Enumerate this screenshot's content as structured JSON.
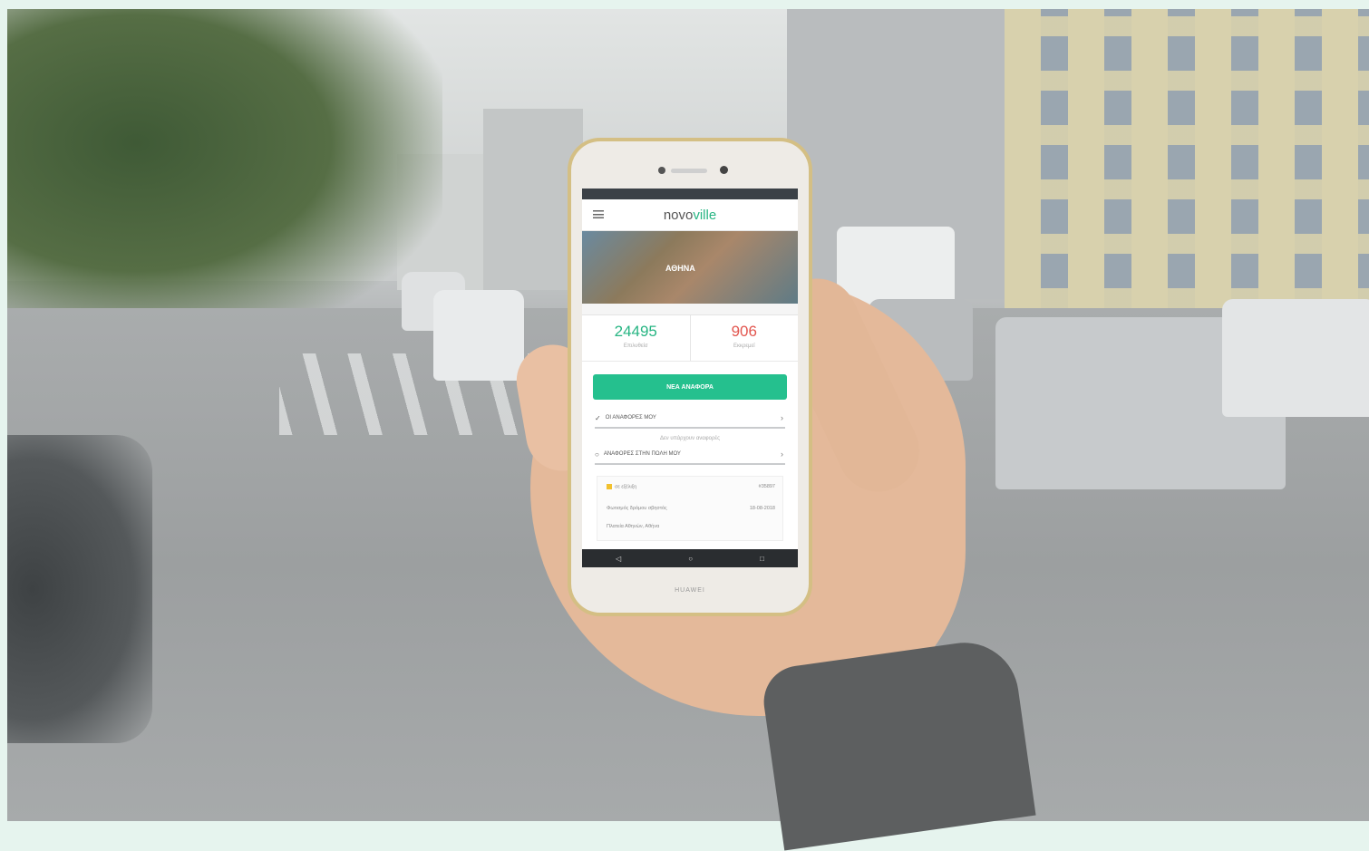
{
  "app": {
    "brand_part1": "novo",
    "brand_part2": "ville",
    "city_label": "ΑΘΗΝΑ"
  },
  "stats": [
    {
      "value": "24495",
      "caption": "Επιλυθείσ"
    },
    {
      "value": "906",
      "caption": "Εκκρεμεί"
    }
  ],
  "cta_label": "ΝΕΑ ΑΝΑΦΟΡΑ",
  "sections": {
    "my_reports": "ΟΙ ΑΝΑΦΟΡΕΣ ΜΟΥ",
    "empty_note": "Δεν υπάρχουν αναφορές",
    "city_reports": "ΑΝΑΦΟΡΕΣ ΣΤΗΝ ΠΟΛΗ ΜΟΥ"
  },
  "report_card": {
    "tag": "σε εξέλιξη",
    "number": "#35897",
    "title": "Φωτισμός δρόμου σβηστός",
    "date": "18-08-2018",
    "address": "Πλατεία Αθηνών, Αθήνα"
  },
  "navbar": {
    "back": "◁",
    "home": "○",
    "recent": "□"
  },
  "device_maker": "HUAWEI",
  "colors": {
    "accent": "#27b583",
    "alert": "#e2564f",
    "cta": "#25c08e"
  }
}
